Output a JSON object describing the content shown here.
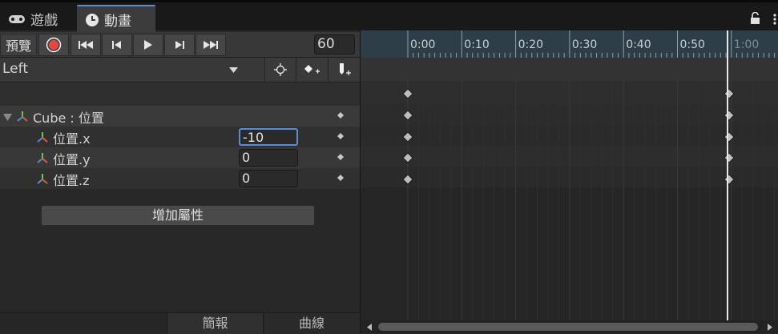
{
  "tabs": [
    {
      "label": "遊戲",
      "icon": "gamepad-icon"
    },
    {
      "label": "動畫",
      "icon": "clock-icon"
    }
  ],
  "toolbar": {
    "preview_label": "預覽",
    "frame_value": "60",
    "record_color": "#e8463e"
  },
  "clip": {
    "selected": "Left"
  },
  "properties": {
    "group_label": "Cube : 位置",
    "rows": [
      {
        "label": "位置.x",
        "value": "-10"
      },
      {
        "label": "位置.y",
        "value": "0"
      },
      {
        "label": "位置.z",
        "value": "0"
      }
    ],
    "add_property_label": "增加屬性"
  },
  "bottom_tabs": [
    "簡報",
    "曲線"
  ],
  "timeline": {
    "ticks": [
      "0:00",
      "0:10",
      "0:20",
      "0:30",
      "0:40",
      "0:50",
      "1:00"
    ],
    "accent_color": "#5b8bd2"
  }
}
